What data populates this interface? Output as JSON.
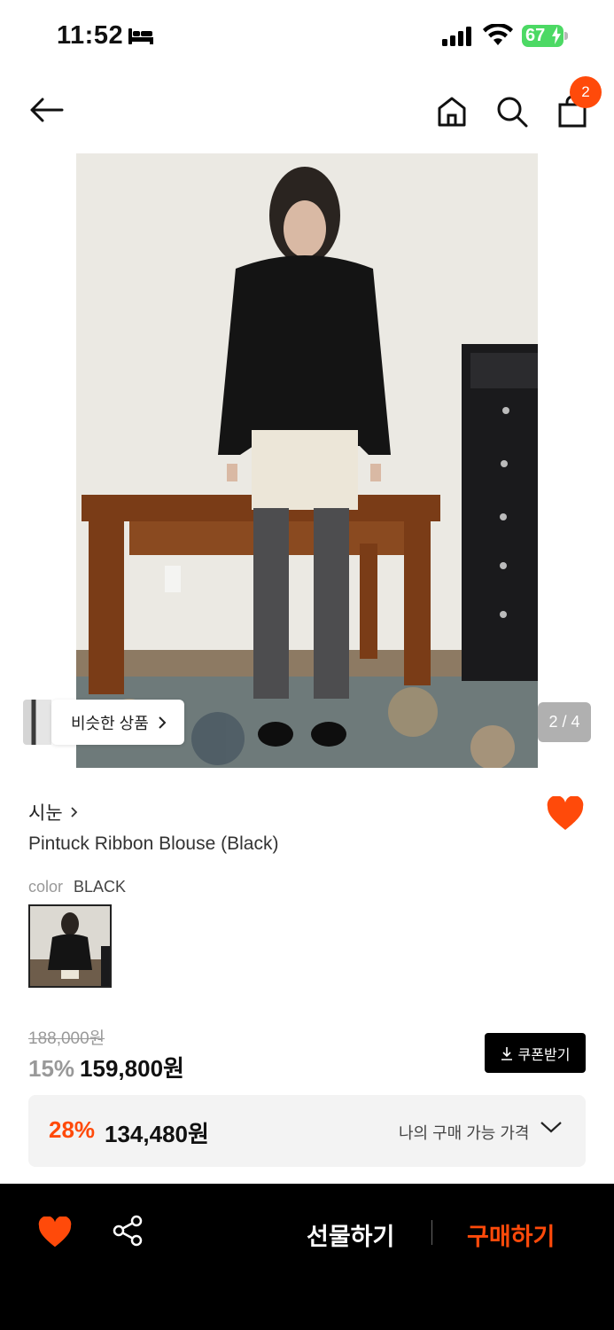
{
  "status_bar": {
    "time": "11:52",
    "battery": "67"
  },
  "header": {
    "cart_count": "2"
  },
  "gallery": {
    "similar_label": "비슷한 상품",
    "pager": "2 / 4"
  },
  "product": {
    "brand": "시눈",
    "name": "Pintuck Ribbon Blouse (Black)",
    "color_key": "color",
    "color_value": "BLACK"
  },
  "pricing": {
    "original": "188,000원",
    "discount_rate": "15%",
    "sale_price": "159,800원",
    "coupon_label": "쿠폰받기",
    "my_rate": "28%",
    "my_price": "134,480원",
    "my_label": "나의 구매 가능 가격"
  },
  "bottom_bar": {
    "gift_label": "선물하기",
    "buy_label": "구매하기"
  },
  "colors": {
    "accent": "#ff4a0a",
    "bar": "#000000"
  }
}
